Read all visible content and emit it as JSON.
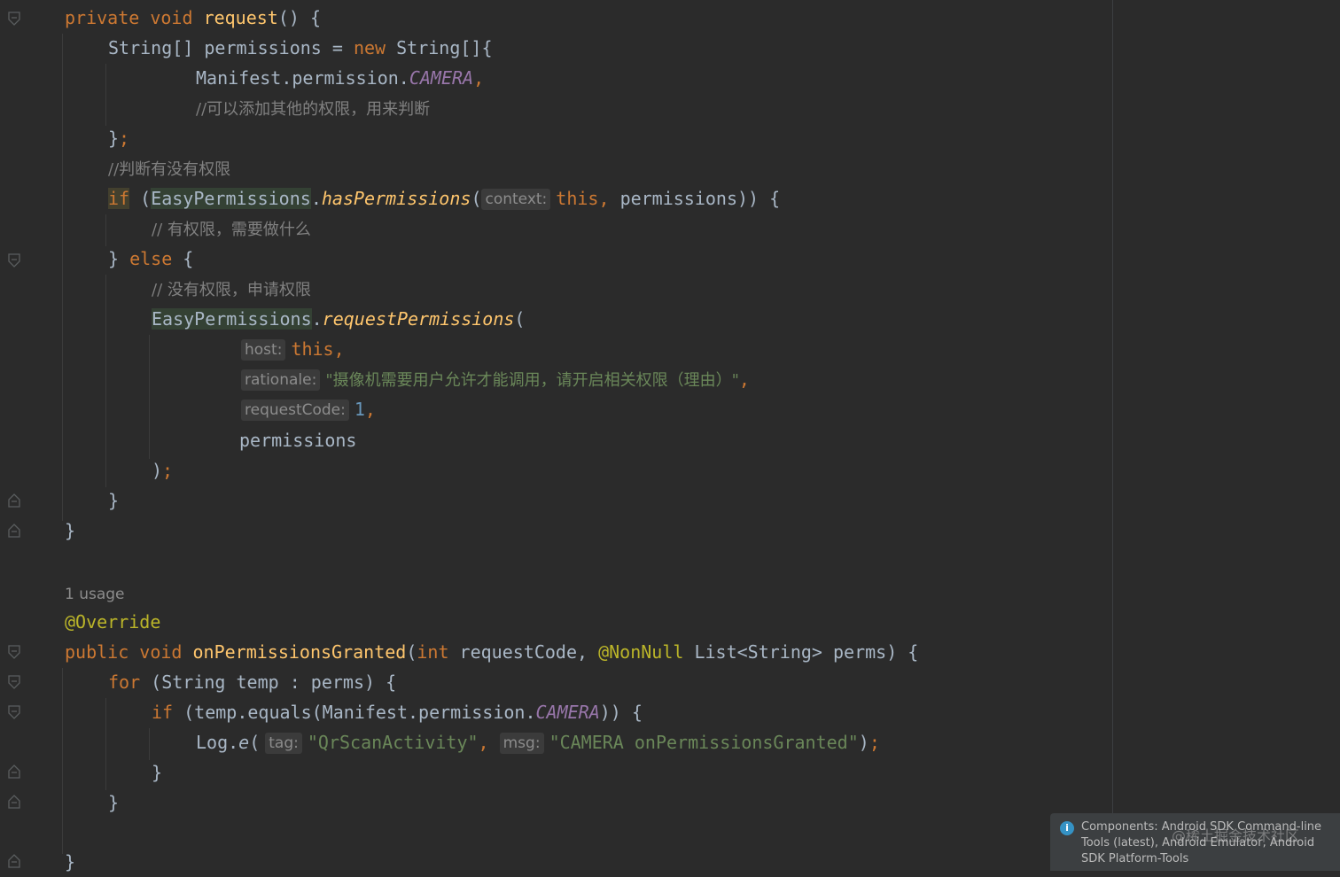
{
  "editor": {
    "lines": [
      [
        "private",
        " ",
        "void",
        " ",
        "request",
        "() {"
      ],
      [
        "String[] permissions = ",
        "new",
        " String[]{"
      ],
      [
        "Manifest.permission.",
        "CAMERA",
        ","
      ],
      [
        "//可以添加其他的权限，用来判断"
      ],
      [
        "}",
        ";"
      ],
      [
        "//判断有没有权限"
      ],
      [
        "if",
        " (",
        "EasyPermissions",
        ".",
        "hasPermissions",
        "(",
        "context:",
        "this",
        ", ",
        "permissions)) {"
      ],
      [
        "// 有权限，需要做什么"
      ],
      [
        "} ",
        "else",
        " {"
      ],
      [
        "// 没有权限，申请权限"
      ],
      [
        "EasyPermissions",
        ".",
        "requestPermissions",
        "("
      ],
      [
        "host:",
        "this",
        ","
      ],
      [
        "rationale:",
        "\"摄像机需要用户允许才能调用，请开启相关权限（理由）\"",
        ","
      ],
      [
        "requestCode:",
        "1",
        ","
      ],
      [
        "permissions"
      ],
      [
        ")",
        ";"
      ],
      [
        "}"
      ],
      [
        "}"
      ],
      [
        "1 usage"
      ],
      [
        "@Override"
      ],
      [
        "public",
        " ",
        "void",
        " ",
        "onPermissionsGranted",
        "(",
        "int",
        " requestCode, ",
        "@NonNull",
        " List<String> perms) {"
      ],
      [
        "for",
        " (String temp : perms) {"
      ],
      [
        "if",
        " (temp.equals(Manifest.permission.",
        "CAMERA",
        ")) {"
      ],
      [
        "Log.",
        "e",
        "(",
        "tag:",
        "\"QrScanActivity\"",
        ", ",
        "msg:",
        "\"CAMERA onPermissionsGranted\"",
        ")",
        ";"
      ],
      [
        "}"
      ],
      [
        "}"
      ],
      [
        "}"
      ]
    ]
  },
  "notification": {
    "text": "Components: Android SDK Command-line Tools (latest), Android Emulator, Android SDK Platform-Tools",
    "icon": "info-icon"
  },
  "watermark": "@稀土掘金技术社区"
}
